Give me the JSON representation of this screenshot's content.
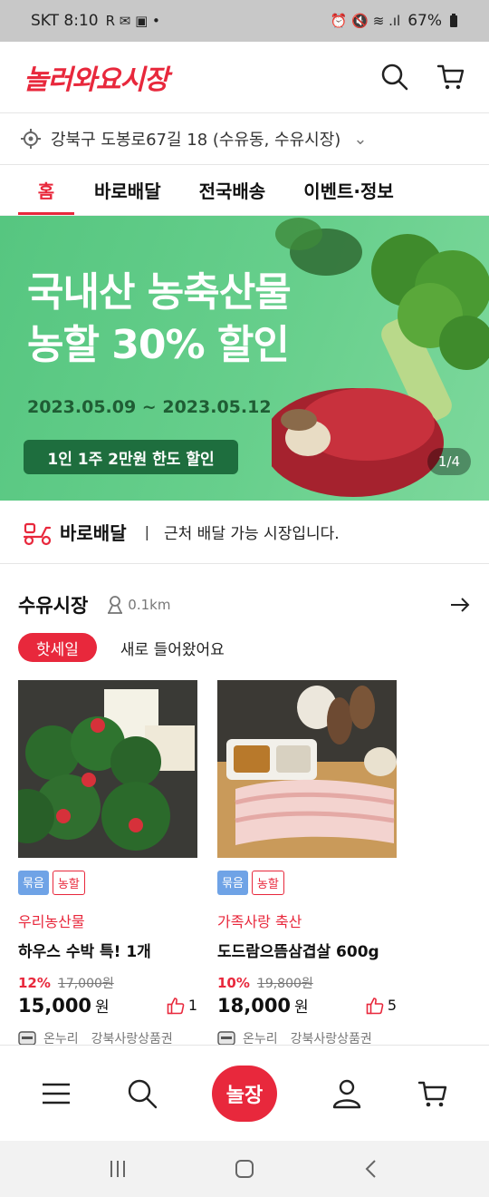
{
  "status_bar": {
    "carrier_time": "SKT 8:10",
    "left_glyphs": "R ✉ ▣ •",
    "right_glyphs": "⏰ 🔇 ≋ .ıl",
    "battery": "67%"
  },
  "header": {
    "logo_text": "놀러와요시장",
    "search_icon": "search-icon",
    "cart_icon": "cart-icon"
  },
  "location": {
    "address": "강북구 도봉로67길 18 (수유동, 수유시장)",
    "target_icon": "location-target-icon",
    "chevron": "⌄"
  },
  "tabs": [
    {
      "label": "홈",
      "active": true
    },
    {
      "label": "바로배달",
      "active": false
    },
    {
      "label": "전국배송",
      "active": false
    },
    {
      "label": "이벤트·정보",
      "active": false
    }
  ],
  "banner": {
    "title_line1": "국내산 농축산물",
    "title_line2": "농할 30% 할인",
    "date_range": "2023.05.09 ~ 2023.05.12",
    "pill": "1인 1주 2만원 한도 할인",
    "counter": "1/4"
  },
  "quick_delivery": {
    "title": "바로배달",
    "separator": "|",
    "description": "근처 배달 가능 시장입니다."
  },
  "market": {
    "name": "수유시장",
    "distance": "0.1km"
  },
  "filter_chips": [
    {
      "label": "핫세일",
      "active": true
    },
    {
      "label": "새로 들어왔어요",
      "active": false
    }
  ],
  "products": [
    {
      "tags": [
        "묶음",
        "농할"
      ],
      "category": "우리농산물",
      "name": "하우스 수박 특! 1개",
      "discount": "12%",
      "original_price": "17,000원",
      "price": "15,000",
      "currency": "원",
      "likes": "1",
      "payments": [
        "온누리",
        "강북사랑상품권"
      ]
    },
    {
      "tags": [
        "묶음",
        "농할"
      ],
      "category": "가족사랑 축산",
      "name": "도드람으뜸삼겹살 600g",
      "discount": "10%",
      "original_price": "19,800원",
      "price": "18,000",
      "currency": "원",
      "likes": "5",
      "payments": [
        "온누리",
        "강북사랑상품권"
      ]
    }
  ],
  "bottom_nav": {
    "home_label": "놀장",
    "items": [
      "menu-icon",
      "search-icon",
      "home",
      "user-icon",
      "cart-icon"
    ]
  },
  "colors": {
    "brand_red": "#e8283c",
    "banner_green": "#5fca86",
    "tag_blue": "#6fa3e6"
  }
}
